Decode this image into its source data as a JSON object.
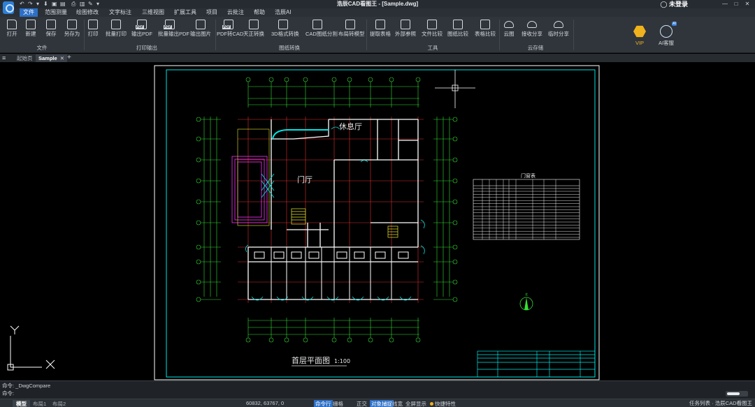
{
  "app": {
    "window_title": "浩辰CAD看图王 - [Sample.dwg]",
    "login_label": "未登录",
    "window_controls": [
      "—",
      "□",
      "✕"
    ]
  },
  "quick_access": [
    "↶",
    "↷",
    "▾",
    "⬇",
    "▣",
    "▤",
    "⎙",
    "▥",
    "✎",
    "▾"
  ],
  "menu": [
    "文件",
    "范围测量",
    "绘图修改",
    "文字标注",
    "三维视图",
    "扩展工具",
    "项目",
    "云批注",
    "帮助",
    "浩辰AI"
  ],
  "menu_active": "文件",
  "ribbon": {
    "buttons": [
      "打开",
      "新建",
      "保存",
      "另存为",
      "打印",
      "批量打印",
      "输出PDF",
      "批量输出PDF",
      "输出图片",
      "PDF转CAD",
      "天正转换",
      "3D格式转换",
      "CAD图纸分割",
      "布局转模型",
      "提取表格",
      "外部参照",
      "文件比较",
      "图纸比较",
      "表格比较",
      "云图",
      "接收分享",
      "临时分享"
    ],
    "groups": [
      "文件",
      "打印输出",
      "图纸转换",
      "工具",
      "云存储"
    ],
    "vip_label": "VIP",
    "ai_label": "AI客服"
  },
  "tabs": {
    "items": [
      "起始页",
      "Sample"
    ],
    "active": "Sample",
    "new_tab": "+"
  },
  "drawing": {
    "title": "首层平面图",
    "scale": "1:100",
    "room_labels": [
      "休息厅",
      "门厅"
    ],
    "table_title": "门窗表",
    "north_label": "北"
  },
  "command": {
    "history": "命令: _DwgCompare",
    "prompt": "命令:",
    "input_value": ""
  },
  "status": {
    "layout_tabs": [
      "模型",
      "布局1",
      "布局2"
    ],
    "coordinates": "60832, 63767, 0",
    "toggles": [
      "命令行",
      "栅格",
      "正交",
      "对象捕捉",
      "线宽",
      "全屏显示"
    ],
    "toggles_on": [
      "命令行",
      "对象捕捉"
    ],
    "shortcut_label": "快捷特性",
    "right_text": "任务列表 · 浩辰CAD看图王"
  },
  "colors": {
    "accent": "#2d6fc5",
    "vip": "#f0b21d",
    "cad_cyan": "#00e5e5",
    "cad_red": "#e03030",
    "cad_green": "#33e033",
    "cad_magenta": "#ff33ff",
    "cad_yellow": "#e8e830"
  }
}
